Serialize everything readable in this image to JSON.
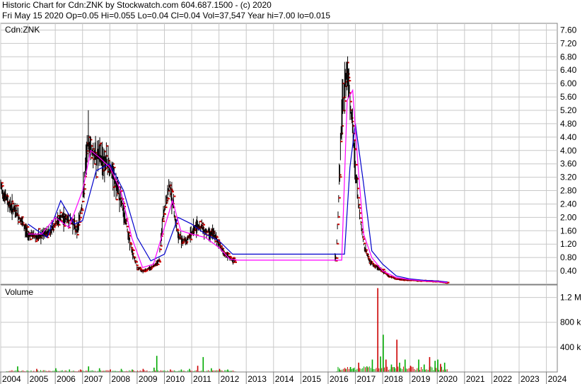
{
  "header": {
    "line1": "Historic Chart for Cdn:ZNK by Stockwatch.com 604.687.1500 - (c) 2020",
    "line2": "Fri May 15 2020   Op=0.05  Hi=0.055  Lo=0.04  Cl=0.04  Vol=37,547  Year hi=7.00  lo=0.015"
  },
  "chart_data": [
    {
      "type": "line",
      "title": "Cdn:ZNK",
      "ylim": [
        0,
        7.8
      ],
      "yticks": [
        "0.40",
        "0.80",
        "1.20",
        "1.60",
        "2.00",
        "2.40",
        "2.80",
        "3.20",
        "3.60",
        "4.00",
        "4.40",
        "4.80",
        "5.20",
        "5.60",
        "6.00",
        "6.40",
        "6.80",
        "7.20",
        "7.60"
      ],
      "xlim": [
        2004,
        2024.4
      ],
      "xticks": [
        "2004",
        "2005",
        "2006",
        "2007",
        "2008",
        "2009",
        "2010",
        "2011",
        "2012",
        "2013",
        "2014",
        "2015",
        "2016",
        "2017",
        "2018",
        "2019",
        "2020",
        "2021",
        "2022",
        "2023",
        "2024"
      ],
      "grid": true,
      "colors": {
        "high_low_bar": "#000000",
        "close_tick": "#cc0000",
        "short_ma": "#ff00ff",
        "long_ma": "#0000cc"
      },
      "series": [
        {
          "x": [
            2004.0,
            2004.3,
            2004.6,
            2005.0,
            2005.4,
            2005.8,
            2006.2,
            2006.6,
            2006.8,
            2007.0,
            2007.2,
            2007.4,
            2007.8,
            2008.0,
            2008.2,
            2008.4,
            2008.6,
            2008.8,
            2009.0,
            2009.2,
            2009.5,
            2009.8,
            2009.95,
            2010.2,
            2010.5,
            2010.8,
            2011.2,
            2011.5,
            2011.8,
            2012.0,
            2012.2,
            2012.5,
            2016.3,
            2016.5,
            2016.7,
            2016.8,
            2016.95,
            2017.1,
            2017.3,
            2017.5,
            2017.7,
            2017.9,
            2018.2,
            2018.5,
            2019.0,
            2019.5,
            2020.0,
            2020.37
          ],
          "values": [
            2.9,
            2.4,
            2.1,
            1.5,
            1.4,
            1.6,
            2.0,
            1.9,
            1.6,
            2.5,
            4.3,
            3.9,
            3.7,
            3.5,
            3.0,
            2.5,
            1.8,
            1.0,
            0.5,
            0.4,
            0.5,
            0.7,
            2.0,
            3.0,
            1.4,
            1.3,
            1.8,
            1.6,
            1.5,
            1.2,
            0.9,
            0.7,
            0.8,
            5.0,
            6.6,
            5.6,
            4.0,
            2.5,
            1.2,
            0.7,
            0.55,
            0.45,
            0.25,
            0.15,
            0.12,
            0.1,
            0.08,
            0.04
          ]
        },
        {
          "x": [
            2005.0,
            2005.5,
            2006.0,
            2006.5,
            2007.0,
            2007.3,
            2007.6,
            2008.0,
            2008.4,
            2008.8,
            2009.2,
            2009.6,
            2010.0,
            2010.3,
            2010.6,
            2011.0,
            2011.5,
            2012.0,
            2012.4,
            2012.7,
            2016.5,
            2016.7,
            2016.9,
            2017.1,
            2017.3,
            2017.6,
            2018.0,
            2018.5,
            2019.0,
            2019.5,
            2020.0,
            2020.37
          ],
          "values": [
            1.5,
            1.5,
            2.0,
            1.7,
            2.8,
            4.0,
            3.8,
            3.5,
            2.8,
            1.4,
            0.5,
            0.6,
            1.7,
            2.5,
            1.6,
            1.5,
            1.4,
            1.1,
            0.75,
            0.72,
            0.72,
            5.5,
            5.8,
            3.5,
            1.5,
            0.8,
            0.4,
            0.2,
            0.14,
            0.1,
            0.08,
            0.05
          ]
        },
        {
          "x": [
            2005.0,
            2005.7,
            2006.2,
            2006.7,
            2007.0,
            2007.5,
            2008.0,
            2008.5,
            2009.0,
            2009.5,
            2010.0,
            2010.5,
            2011.0,
            2011.5,
            2012.0,
            2012.5,
            2016.6,
            2016.8,
            2017.0,
            2017.3,
            2017.6,
            2018.0,
            2018.5,
            2019.0,
            2019.5,
            2020.0,
            2020.37
          ],
          "values": [
            1.8,
            1.4,
            2.5,
            1.8,
            1.9,
            3.4,
            3.6,
            2.8,
            1.4,
            0.7,
            0.9,
            2.0,
            1.8,
            1.5,
            1.3,
            0.9,
            0.9,
            3.5,
            4.8,
            3.0,
            1.0,
            0.6,
            0.25,
            0.16,
            0.12,
            0.1,
            0.07
          ]
        }
      ]
    },
    {
      "type": "bar",
      "title": "Volume",
      "ylim": [
        0,
        1400000
      ],
      "yticks": [
        "400 k",
        "800 k",
        "1.2 M"
      ],
      "xlim": [
        2004,
        2024.4
      ],
      "colors": {
        "up": "#00aa00",
        "down": "#cc0000"
      },
      "x": [
        2004.6,
        2005.3,
        2006.0,
        2006.5,
        2006.9,
        2007.2,
        2007.6,
        2008.0,
        2008.4,
        2008.8,
        2009.2,
        2009.6,
        2009.7,
        2010.2,
        2010.6,
        2010.9,
        2011.2,
        2011.4,
        2011.7,
        2012.0,
        2012.3,
        2016.4,
        2016.6,
        2016.8,
        2016.9,
        2017.1,
        2017.4,
        2017.6,
        2017.8,
        2017.9,
        2018.0,
        2018.1,
        2018.3,
        2018.4,
        2018.5,
        2018.6,
        2018.8,
        2019.0,
        2019.3,
        2019.5,
        2019.7,
        2019.9,
        2020.0,
        2020.1,
        2020.25
      ],
      "values": [
        90000,
        50000,
        60000,
        40000,
        40000,
        90000,
        60000,
        40000,
        50000,
        40000,
        50000,
        70000,
        260000,
        40000,
        40000,
        50000,
        100000,
        240000,
        60000,
        50000,
        40000,
        40000,
        50000,
        80000,
        60000,
        150000,
        90000,
        200000,
        1350000,
        250000,
        600000,
        200000,
        120000,
        80000,
        520000,
        150000,
        200000,
        100000,
        200000,
        120000,
        240000,
        180000,
        200000,
        130000,
        150000
      ]
    }
  ]
}
